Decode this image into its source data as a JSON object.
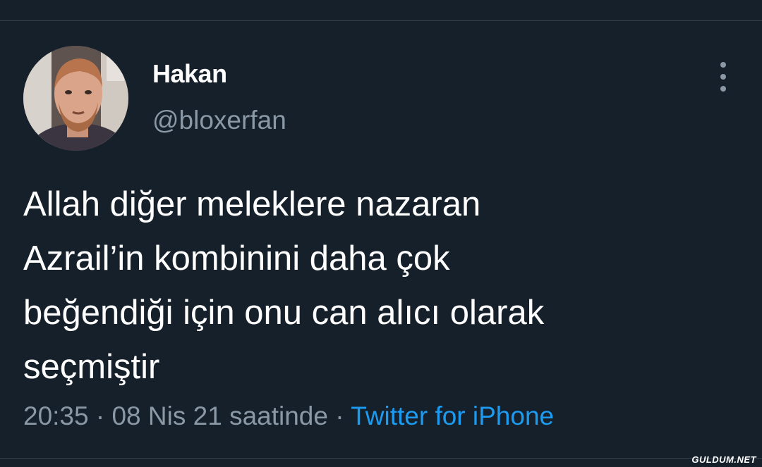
{
  "tweet": {
    "author_name": "Hakan",
    "author_handle": "@bloxerfan",
    "text_lines": [
      "Allah diğer meleklere nazaran",
      "Azrail’in kombinini daha çok",
      "beğendiği için onu can alıcı olarak",
      "seçmiştir"
    ],
    "time": "20:35",
    "separator": "·",
    "date": "08 Nis 21 saatinde",
    "source": "Twitter for iPhone"
  },
  "icons": {
    "more": "more-vertical-icon"
  },
  "watermark": "GULDUM.NET",
  "colors": {
    "background": "#15202b",
    "text": "#ffffff",
    "secondary_text": "#8b98a5",
    "link": "#1d9bf0",
    "divider": "#38444d"
  }
}
